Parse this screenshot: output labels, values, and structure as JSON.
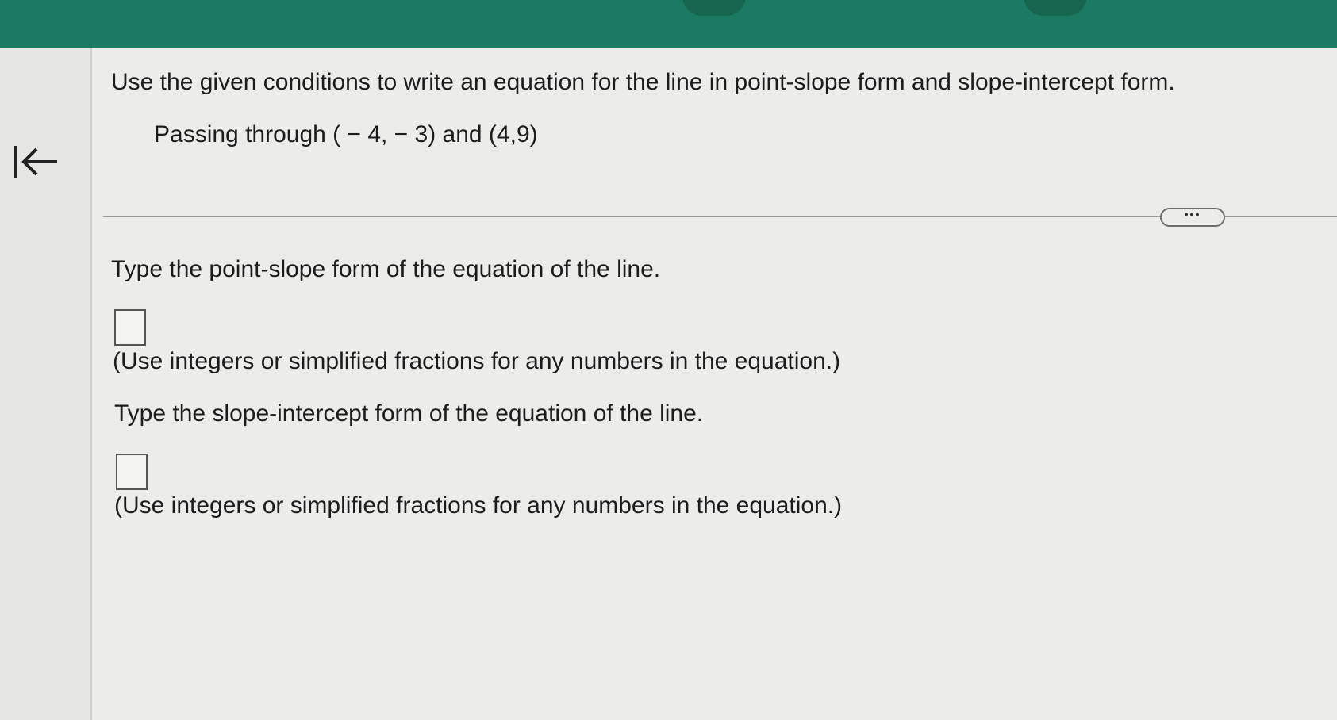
{
  "header": {
    "bar_color": "#1d7a62"
  },
  "nav": {
    "back_icon": "first-page-arrow-icon"
  },
  "question": {
    "instruction": "Use the given conditions to write an equation for the line in point-slope form and slope-intercept form.",
    "condition": "Passing through ( − 4, − 3) and (4,9)",
    "more_label": "•••"
  },
  "parts": [
    {
      "prompt": "Type the point-slope form of the equation of the line.",
      "answer": "",
      "hint": "(Use integers or simplified fractions for any numbers in the equation.)"
    },
    {
      "prompt": "Type the slope-intercept form of the equation of the line.",
      "answer": "",
      "hint": "(Use integers or simplified fractions for any numbers in the equation.)"
    }
  ]
}
